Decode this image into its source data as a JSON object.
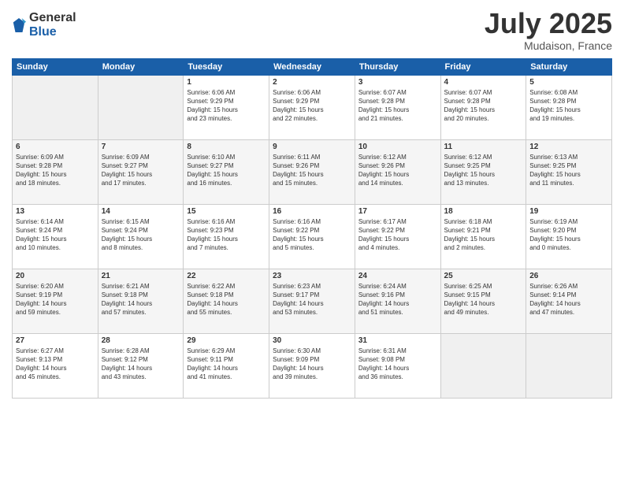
{
  "logo": {
    "general": "General",
    "blue": "Blue"
  },
  "title": {
    "month": "July 2025",
    "location": "Mudaison, France"
  },
  "weekdays": [
    "Sunday",
    "Monday",
    "Tuesday",
    "Wednesday",
    "Thursday",
    "Friday",
    "Saturday"
  ],
  "weeks": [
    [
      {
        "day": "",
        "info": ""
      },
      {
        "day": "",
        "info": ""
      },
      {
        "day": "1",
        "info": "Sunrise: 6:06 AM\nSunset: 9:29 PM\nDaylight: 15 hours\nand 23 minutes."
      },
      {
        "day": "2",
        "info": "Sunrise: 6:06 AM\nSunset: 9:29 PM\nDaylight: 15 hours\nand 22 minutes."
      },
      {
        "day": "3",
        "info": "Sunrise: 6:07 AM\nSunset: 9:28 PM\nDaylight: 15 hours\nand 21 minutes."
      },
      {
        "day": "4",
        "info": "Sunrise: 6:07 AM\nSunset: 9:28 PM\nDaylight: 15 hours\nand 20 minutes."
      },
      {
        "day": "5",
        "info": "Sunrise: 6:08 AM\nSunset: 9:28 PM\nDaylight: 15 hours\nand 19 minutes."
      }
    ],
    [
      {
        "day": "6",
        "info": "Sunrise: 6:09 AM\nSunset: 9:28 PM\nDaylight: 15 hours\nand 18 minutes."
      },
      {
        "day": "7",
        "info": "Sunrise: 6:09 AM\nSunset: 9:27 PM\nDaylight: 15 hours\nand 17 minutes."
      },
      {
        "day": "8",
        "info": "Sunrise: 6:10 AM\nSunset: 9:27 PM\nDaylight: 15 hours\nand 16 minutes."
      },
      {
        "day": "9",
        "info": "Sunrise: 6:11 AM\nSunset: 9:26 PM\nDaylight: 15 hours\nand 15 minutes."
      },
      {
        "day": "10",
        "info": "Sunrise: 6:12 AM\nSunset: 9:26 PM\nDaylight: 15 hours\nand 14 minutes."
      },
      {
        "day": "11",
        "info": "Sunrise: 6:12 AM\nSunset: 9:25 PM\nDaylight: 15 hours\nand 13 minutes."
      },
      {
        "day": "12",
        "info": "Sunrise: 6:13 AM\nSunset: 9:25 PM\nDaylight: 15 hours\nand 11 minutes."
      }
    ],
    [
      {
        "day": "13",
        "info": "Sunrise: 6:14 AM\nSunset: 9:24 PM\nDaylight: 15 hours\nand 10 minutes."
      },
      {
        "day": "14",
        "info": "Sunrise: 6:15 AM\nSunset: 9:24 PM\nDaylight: 15 hours\nand 8 minutes."
      },
      {
        "day": "15",
        "info": "Sunrise: 6:16 AM\nSunset: 9:23 PM\nDaylight: 15 hours\nand 7 minutes."
      },
      {
        "day": "16",
        "info": "Sunrise: 6:16 AM\nSunset: 9:22 PM\nDaylight: 15 hours\nand 5 minutes."
      },
      {
        "day": "17",
        "info": "Sunrise: 6:17 AM\nSunset: 9:22 PM\nDaylight: 15 hours\nand 4 minutes."
      },
      {
        "day": "18",
        "info": "Sunrise: 6:18 AM\nSunset: 9:21 PM\nDaylight: 15 hours\nand 2 minutes."
      },
      {
        "day": "19",
        "info": "Sunrise: 6:19 AM\nSunset: 9:20 PM\nDaylight: 15 hours\nand 0 minutes."
      }
    ],
    [
      {
        "day": "20",
        "info": "Sunrise: 6:20 AM\nSunset: 9:19 PM\nDaylight: 14 hours\nand 59 minutes."
      },
      {
        "day": "21",
        "info": "Sunrise: 6:21 AM\nSunset: 9:18 PM\nDaylight: 14 hours\nand 57 minutes."
      },
      {
        "day": "22",
        "info": "Sunrise: 6:22 AM\nSunset: 9:18 PM\nDaylight: 14 hours\nand 55 minutes."
      },
      {
        "day": "23",
        "info": "Sunrise: 6:23 AM\nSunset: 9:17 PM\nDaylight: 14 hours\nand 53 minutes."
      },
      {
        "day": "24",
        "info": "Sunrise: 6:24 AM\nSunset: 9:16 PM\nDaylight: 14 hours\nand 51 minutes."
      },
      {
        "day": "25",
        "info": "Sunrise: 6:25 AM\nSunset: 9:15 PM\nDaylight: 14 hours\nand 49 minutes."
      },
      {
        "day": "26",
        "info": "Sunrise: 6:26 AM\nSunset: 9:14 PM\nDaylight: 14 hours\nand 47 minutes."
      }
    ],
    [
      {
        "day": "27",
        "info": "Sunrise: 6:27 AM\nSunset: 9:13 PM\nDaylight: 14 hours\nand 45 minutes."
      },
      {
        "day": "28",
        "info": "Sunrise: 6:28 AM\nSunset: 9:12 PM\nDaylight: 14 hours\nand 43 minutes."
      },
      {
        "day": "29",
        "info": "Sunrise: 6:29 AM\nSunset: 9:11 PM\nDaylight: 14 hours\nand 41 minutes."
      },
      {
        "day": "30",
        "info": "Sunrise: 6:30 AM\nSunset: 9:09 PM\nDaylight: 14 hours\nand 39 minutes."
      },
      {
        "day": "31",
        "info": "Sunrise: 6:31 AM\nSunset: 9:08 PM\nDaylight: 14 hours\nand 36 minutes."
      },
      {
        "day": "",
        "info": ""
      },
      {
        "day": "",
        "info": ""
      }
    ]
  ]
}
